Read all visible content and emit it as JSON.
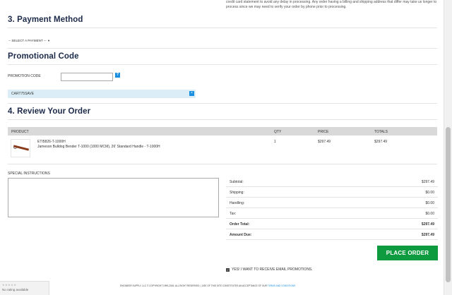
{
  "notice": {
    "text": "credit card statement to avoid any delay in processing. Any order having a billing and shipping address that differ may take us longer to process since we may need to verify your order by phone prior to processing."
  },
  "payment": {
    "title": "3. Payment Method",
    "select_value": "-- SELECT A PAYMENT --"
  },
  "promo": {
    "title": "Promotional Code",
    "label": "PROMOTION CODE",
    "input_value": "",
    "help_glyph": "?",
    "applied_code": "CART75SAVE",
    "remove_glyph": "×"
  },
  "review": {
    "title": "4. Review Your Order",
    "columns": [
      "PRODUCT",
      "QTY",
      "PRICE",
      "TOTALS"
    ],
    "items": [
      {
        "sku": "ETI5826-T-1000H",
        "description": "Jameson Bulldog Bender T-1000 (1000 MCM), 26' Standard Handle - T-1000H",
        "qty": "1",
        "price": "$297.49",
        "total": "$297.49"
      }
    ]
  },
  "instructions": {
    "label": "SPECIAL INSTRUCTIONS",
    "value": ""
  },
  "totals": {
    "rows": [
      {
        "label": "Subtotal:",
        "value": "$297.49"
      },
      {
        "label": "Shipping:",
        "value": "$0.00"
      },
      {
        "label": "Handling:",
        "value": "$0.00"
      },
      {
        "label": "Tax:",
        "value": "$0.00"
      },
      {
        "label": "Order Total:",
        "value": "$297.49"
      },
      {
        "label": "Amount Due:",
        "value": "$297.49"
      }
    ]
  },
  "actions": {
    "place_order": "PLACE ORDER",
    "email_opt_in": "YES! I WANT TO RECEIVE EMAIL PROMOTIONS.",
    "email_checked": true
  },
  "footer": {
    "text": "ENGINEER SUPPLY, LLC © COPYRIGHT 1999-2026. ALL RIGHT RESERVED. | USE OF THIS SITE CONSTITUTES AN ACCEPTANCE OF OUR",
    "link": "TERMS AND CONDITIONS"
  },
  "rating": {
    "stars": "★★★★★",
    "text": "No rating available"
  },
  "colors": {
    "heading": "#1c2a4a",
    "accent_blue": "#1a8fe0",
    "place_order_green": "#0e9a3e",
    "promo_bg": "#dbeef8",
    "table_header_bg": "#d9d9d9"
  }
}
